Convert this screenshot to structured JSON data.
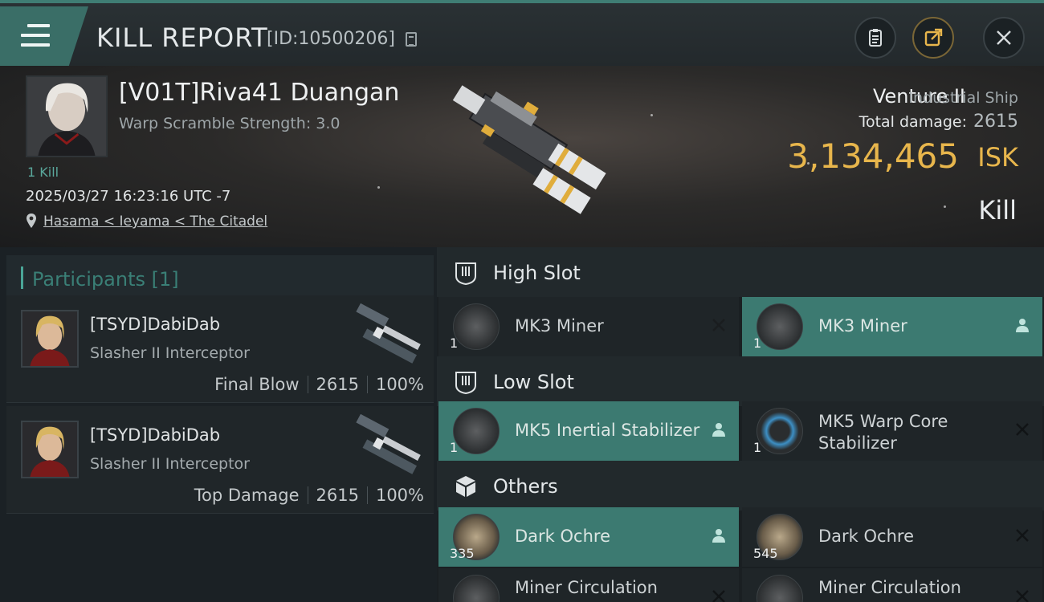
{
  "header": {
    "title": "KILL REPORT",
    "report_id": "[ID:10500206]",
    "icons": [
      "menu-icon",
      "copy-icon",
      "clipboard-icon",
      "share-icon",
      "close-icon"
    ]
  },
  "victim": {
    "name": "[V01T]Riva41 Duangan",
    "warp_scramble": "Warp Scramble Strength: 3.0",
    "kills": "1 Kill",
    "datetime": "2025/03/27 16:23:16 UTC -7",
    "location": "Hasama < Ieyama < The Citadel",
    "ship_name": "Venture II",
    "ship_class": "Industrial Ship",
    "total_damage_label": "Total damage:",
    "total_damage": "2615",
    "isk_value": "3,134,465",
    "isk_label": "ISK",
    "result": "Kill"
  },
  "participants": {
    "title": "Participants [1]",
    "items": [
      {
        "name": "[TSYD]DabiDab",
        "ship": "Slasher II Interceptor",
        "role": "Final Blow",
        "damage": "2615",
        "percent": "100%"
      },
      {
        "name": "[TSYD]DabiDab",
        "ship": "Slasher II Interceptor",
        "role": "Top Damage",
        "damage": "2615",
        "percent": "100%"
      }
    ]
  },
  "fittings": {
    "high_slot": {
      "label": "High Slot",
      "items": [
        {
          "name": "MK3 Miner",
          "qty": "1",
          "state": "destroyed"
        },
        {
          "name": "MK3 Miner",
          "qty": "1",
          "state": "dropped"
        }
      ]
    },
    "low_slot": {
      "label": "Low Slot",
      "items": [
        {
          "name": "MK5 Inertial Stabilizer",
          "qty": "1",
          "state": "dropped"
        },
        {
          "name": "MK5 Warp Core Stabilizer",
          "qty": "1",
          "state": "destroyed"
        }
      ]
    },
    "others": {
      "label": "Others",
      "items": [
        {
          "name": "Dark Ochre",
          "qty": "335",
          "state": "dropped"
        },
        {
          "name": "Dark Ochre",
          "qty": "545",
          "state": "destroyed"
        },
        {
          "name": "Miner Circulation",
          "qty": "",
          "state": "destroyed"
        },
        {
          "name": "Miner Circulation",
          "qty": "",
          "state": "destroyed"
        }
      ]
    }
  },
  "colors": {
    "accent": "#3c7a71",
    "isk": "#e8b64c",
    "panel": "#1f2528"
  }
}
